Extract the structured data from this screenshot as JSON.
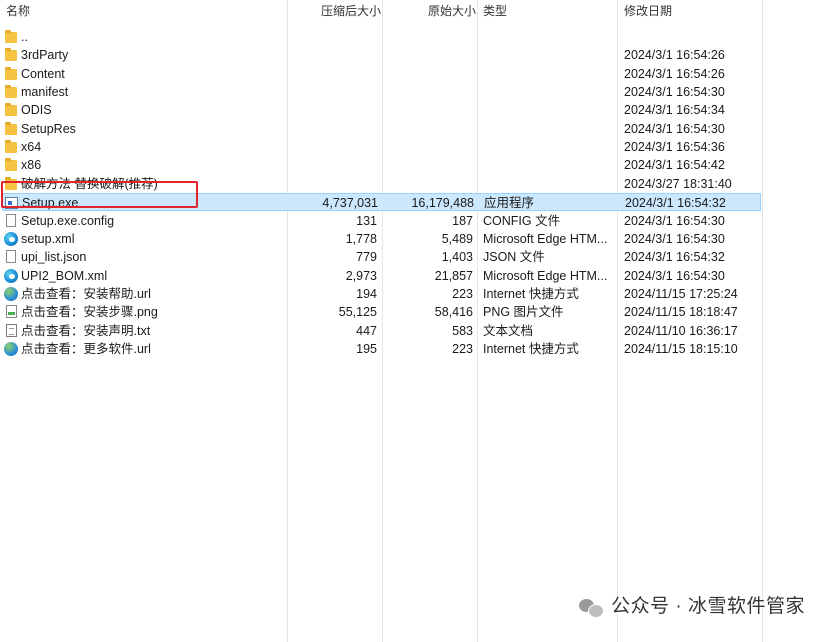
{
  "columns": {
    "name": "名称",
    "compressed_size": "压缩后大小",
    "original_size": "原始大小",
    "type": "类型",
    "modified": "修改日期"
  },
  "rows": [
    {
      "name": "..",
      "icon": "folder-icon",
      "compressed": "",
      "original": "",
      "type": "",
      "date": ""
    },
    {
      "name": "3rdParty",
      "icon": "folder-icon",
      "compressed": "",
      "original": "",
      "type": "",
      "date": "2024/3/1 16:54:26"
    },
    {
      "name": "Content",
      "icon": "folder-icon",
      "compressed": "",
      "original": "",
      "type": "",
      "date": "2024/3/1 16:54:26"
    },
    {
      "name": "manifest",
      "icon": "folder-icon",
      "compressed": "",
      "original": "",
      "type": "",
      "date": "2024/3/1 16:54:30"
    },
    {
      "name": "ODIS",
      "icon": "folder-icon",
      "compressed": "",
      "original": "",
      "type": "",
      "date": "2024/3/1 16:54:34"
    },
    {
      "name": "SetupRes",
      "icon": "folder-icon",
      "compressed": "",
      "original": "",
      "type": "",
      "date": "2024/3/1 16:54:30"
    },
    {
      "name": "x64",
      "icon": "folder-icon",
      "compressed": "",
      "original": "",
      "type": "",
      "date": "2024/3/1 16:54:36"
    },
    {
      "name": "x86",
      "icon": "folder-icon",
      "compressed": "",
      "original": "",
      "type": "",
      "date": "2024/3/1 16:54:42"
    },
    {
      "name": "破解方法 替换破解(推荐)",
      "icon": "folder-icon",
      "compressed": "",
      "original": "",
      "type": "",
      "date": "2024/3/27 18:31:40"
    },
    {
      "name": "Setup.exe",
      "icon": "exe-icon",
      "compressed": "4,737,031",
      "original": "16,179,488",
      "type": "应用程序",
      "date": "2024/3/1 16:54:32",
      "selected": true
    },
    {
      "name": "Setup.exe.config",
      "icon": "file-icon",
      "compressed": "131",
      "original": "187",
      "type": "CONFIG 文件",
      "date": "2024/3/1 16:54:30"
    },
    {
      "name": "setup.xml",
      "icon": "edge-icon",
      "compressed": "1,778",
      "original": "5,489",
      "type": "Microsoft Edge HTM...",
      "date": "2024/3/1 16:54:30"
    },
    {
      "name": "upi_list.json",
      "icon": "file-icon",
      "compressed": "779",
      "original": "1,403",
      "type": "JSON 文件",
      "date": "2024/3/1 16:54:32"
    },
    {
      "name": "UPI2_BOM.xml",
      "icon": "edge-icon",
      "compressed": "2,973",
      "original": "21,857",
      "type": "Microsoft Edge HTM...",
      "date": "2024/3/1 16:54:30"
    },
    {
      "name": "点击查看：安装帮助.url",
      "icon": "globe-icon",
      "compressed": "194",
      "original": "223",
      "type": "Internet 快捷方式",
      "date": "2024/11/15 17:25:24"
    },
    {
      "name": "点击查看：安装步骤.png",
      "icon": "png-icon",
      "compressed": "55,125",
      "original": "58,416",
      "type": "PNG 图片文件",
      "date": "2024/11/15 18:18:47"
    },
    {
      "name": "点击查看：安装声明.txt",
      "icon": "txt-icon",
      "compressed": "447",
      "original": "583",
      "type": "文本文档",
      "date": "2024/11/10 16:36:17"
    },
    {
      "name": "点击查看：更多软件.url",
      "icon": "globe-icon",
      "compressed": "195",
      "original": "223",
      "type": "Internet 快捷方式",
      "date": "2024/11/15 18:15:10"
    }
  ],
  "watermark": {
    "text": "公众号 · 冰雪软件管家"
  }
}
